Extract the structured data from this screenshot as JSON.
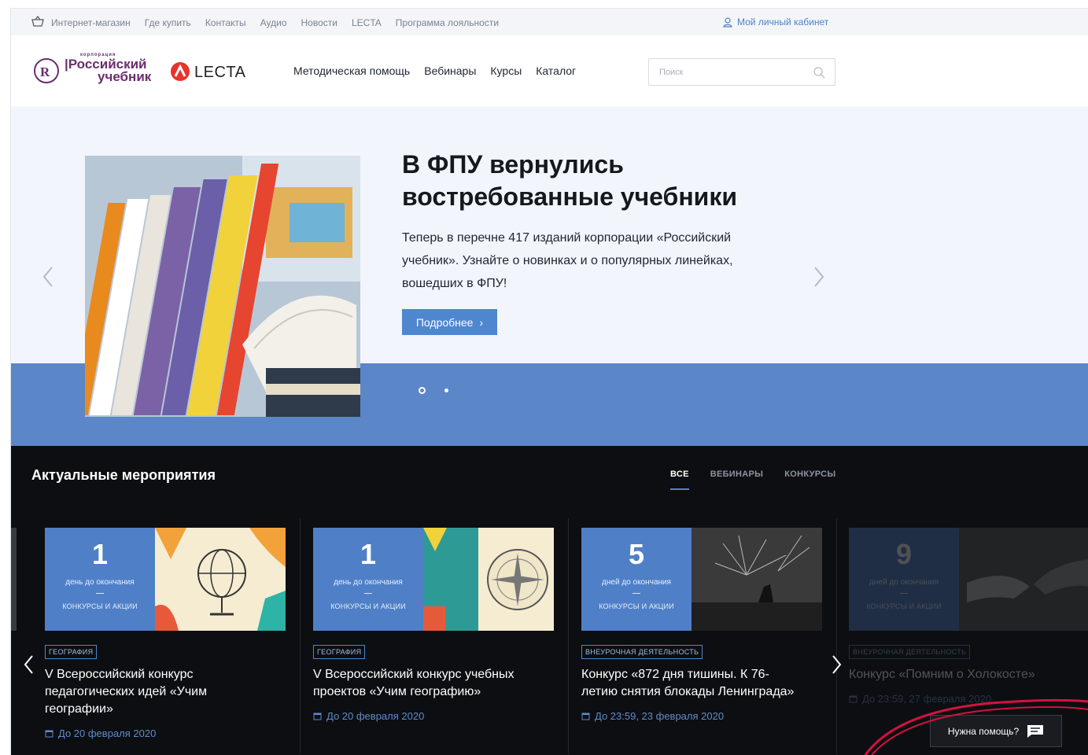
{
  "topbar": {
    "links": [
      "Интернет-магазин",
      "Где купить",
      "Контакты",
      "Аудио",
      "Новости",
      "LECTA",
      "Программа лояльности"
    ],
    "cabinet": "Мой личный кабинет"
  },
  "header": {
    "logo_small": "корпорация",
    "logo_line1": "|Российский",
    "logo_line2": "учебник",
    "lecta": "LECTA",
    "nav": [
      "Методическая помощь",
      "Вебинары",
      "Курсы",
      "Каталог"
    ],
    "search_placeholder": "Поиск"
  },
  "hero": {
    "title_line1": "В ФПУ вернулись",
    "title_line2": "востребованные учебники",
    "text_line1": "Теперь в перечне 417 изданий корпорации «Российский",
    "text_line2": "учебник». Узнайте о новинках и о популярных линейках,",
    "text_line3": "вошедших в ФПУ!",
    "button": "Подробнее",
    "button_chevron": "›",
    "slide_active": 1,
    "slide_count": 2
  },
  "events": {
    "title": "Актуальные мероприятия",
    "tabs": [
      "ВСЕ",
      "ВЕБИНАРЫ",
      "КОНКУРСЫ"
    ],
    "cards": [
      {
        "num": "1",
        "days": "день до окончания",
        "kind": "КОНКУРСЫ И АКЦИИ",
        "tag": "ГЕОГРАФИЯ",
        "name_l1": "V Всероссийский конкурс",
        "name_l2": "педагогических идей «Учим",
        "name_l3": "географии»",
        "date": "До 20 февраля 2020"
      },
      {
        "num": "1",
        "days": "день до окончания",
        "kind": "КОНКУРСЫ И АКЦИИ",
        "tag": "ГЕОГРАФИЯ",
        "name_l1": "V Всероссийский конкурс учебных",
        "name_l2": "проектов «Учим географию»",
        "name_l3": "",
        "date": "До 20 февраля 2020"
      },
      {
        "num": "5",
        "days": "дней до окончания",
        "kind": "КОНКУРСЫ И АКЦИИ",
        "tag": "ВНЕУРОЧНАЯ ДЕЯТЕЛЬНОСТЬ",
        "name_l1": "Конкурс «872 дня тишины. К 76-",
        "name_l2": "летию снятия блокады Ленинграда»",
        "name_l3": "",
        "date": "До 23:59, 23 февраля 2020"
      },
      {
        "num": "9",
        "days": "дней до окончания",
        "kind": "КОНКУРСЫ И АКЦИИ",
        "tag": "ВНЕУРОЧНАЯ ДЕЯТЕЛЬНОСТЬ",
        "name_l1": "Конкурс «Помним о Холокосте»",
        "name_l2": "",
        "name_l3": "",
        "date": "До 23:59, 27 февраля 2020"
      }
    ]
  },
  "help": {
    "label": "Нужна помощь?"
  },
  "colors": {
    "accent": "#4f86d0",
    "band": "#5b86c8",
    "dark": "#0d0e11",
    "annotation": "#d3123f"
  }
}
